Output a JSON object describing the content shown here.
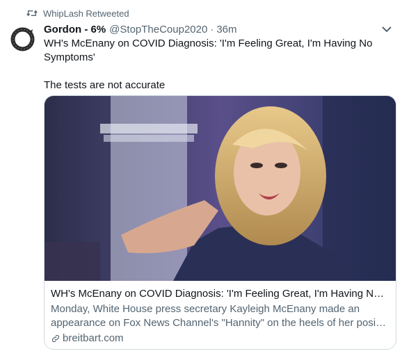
{
  "retweet": {
    "label": "WhipLash Retweeted",
    "icon": "retweet-icon"
  },
  "author": {
    "display_name": "Gordon - 6%",
    "handle": "@StopTheCoup2020",
    "separator": "·",
    "time": "36m",
    "avatar_icon": "ouroboros-avatar"
  },
  "tweet": {
    "line1": "WH's McEnany on COVID Diagnosis: 'I'm Feeling Great, I'm Having No",
    "line2": "Symptoms'",
    "line3": "The tests are not accurate"
  },
  "card": {
    "title": "WH's McEnany on COVID Diagnosis: 'I'm Feeling Great, I'm Having No S...",
    "desc_line1": "Monday, White House press secretary Kayleigh McEnany made an",
    "desc_line2": "appearance on Fox News Channel's \"Hannity\" on the heels of her positi...",
    "domain": "breitbart.com",
    "image_icon": "news-photo"
  },
  "colors": {
    "text": "#0f1419",
    "secondary": "#536471",
    "border": "#cfd9de"
  }
}
